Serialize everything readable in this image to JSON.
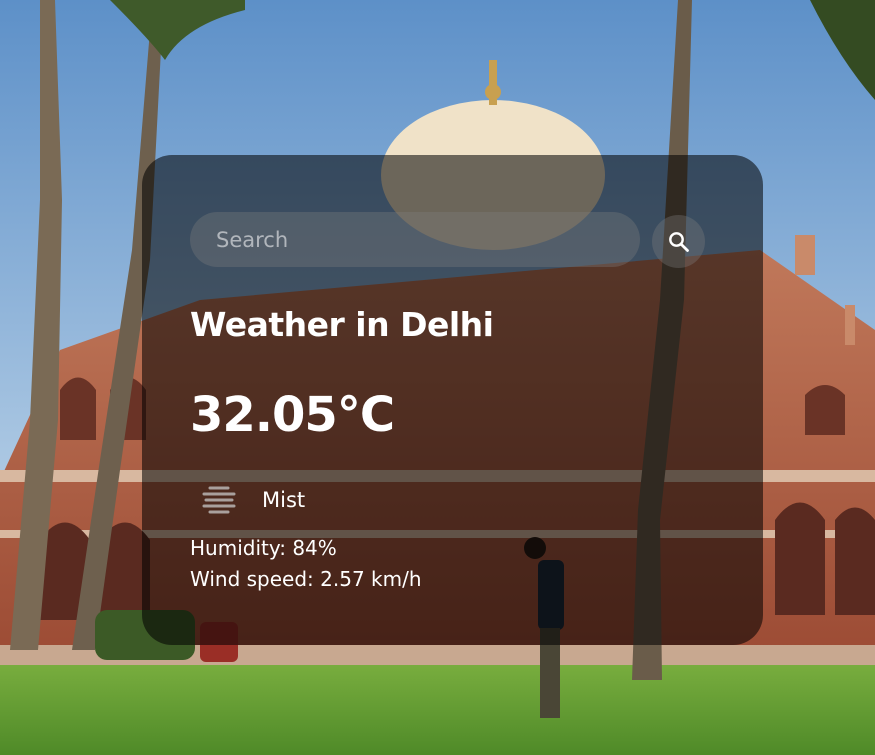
{
  "search": {
    "placeholder": "Search",
    "value": ""
  },
  "weather": {
    "title": "Weather in Delhi",
    "temperature": "32.05°C",
    "description": "Mist",
    "description_icon": "mist-icon",
    "humidity": "Humidity: 84%",
    "wind": "Wind speed: 2.57 km/h"
  },
  "colors": {
    "card_background": "#000000",
    "text": "#ffffff",
    "sky": "#6f9fd0",
    "monument": "#a85a3f",
    "dome": "#efe0c8",
    "lawn": "#5e9a32"
  },
  "icons": {
    "search_button": "search-icon"
  }
}
